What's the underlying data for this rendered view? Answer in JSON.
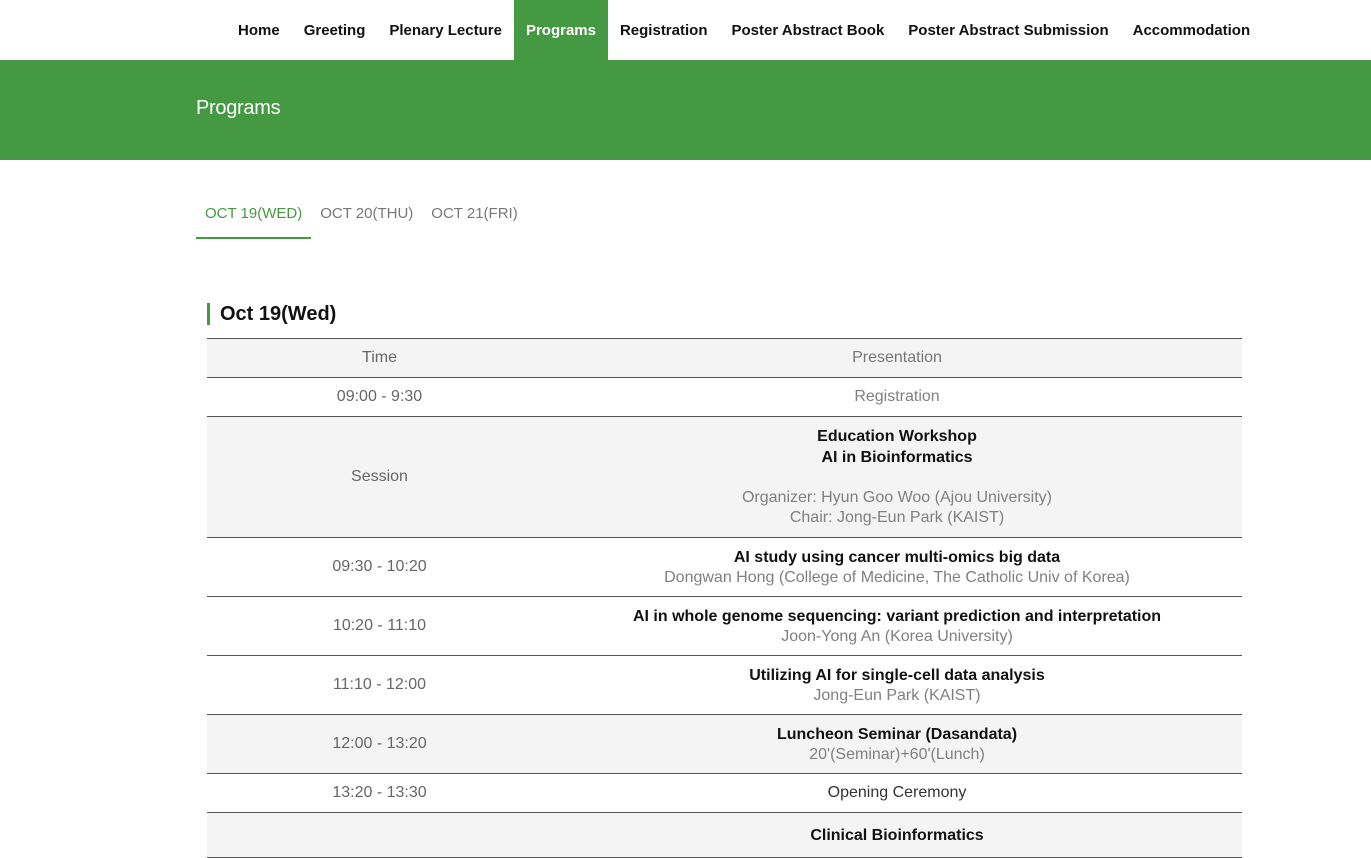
{
  "nav": {
    "items": [
      {
        "label": "Home",
        "active": false
      },
      {
        "label": "Greeting",
        "active": false
      },
      {
        "label": "Plenary Lecture",
        "active": false
      },
      {
        "label": "Programs",
        "active": true
      },
      {
        "label": "Registration",
        "active": false
      },
      {
        "label": "Poster Abstract Book",
        "active": false
      },
      {
        "label": "Poster Abstract Submission",
        "active": false
      },
      {
        "label": "Accommodation",
        "active": false
      }
    ]
  },
  "banner": {
    "title": "Programs"
  },
  "day_tabs": [
    {
      "label": "OCT 19(WED)",
      "active": true
    },
    {
      "label": "OCT 20(THU)",
      "active": false
    },
    {
      "label": "OCT 21(FRI)",
      "active": false
    }
  ],
  "day_heading": "Oct 19(Wed)",
  "table": {
    "headers": {
      "time": "Time",
      "presentation": "Presentation"
    },
    "rows": [
      {
        "time": "09:00 - 9:30",
        "plain": "Registration"
      },
      {
        "time": "Session",
        "title1": "Education Workshop",
        "title2": "AI in Bioinformatics",
        "sub1": "Organizer: Hyun Goo Woo (Ajou University)",
        "sub2": "Chair: Jong-Eun Park (KAIST)"
      },
      {
        "time": "09:30 - 10:20",
        "title": "AI study using cancer multi-omics big data",
        "sub": "Dongwan Hong (College of Medicine, The Catholic Univ of Korea)"
      },
      {
        "time": "10:20 - 11:10",
        "title": "AI in whole genome sequencing: variant prediction and interpretation",
        "sub": "Joon-Yong An (Korea University)"
      },
      {
        "time": "11:10 - 12:00",
        "title": "Utilizing AI for single-cell data analysis",
        "sub": "Jong-Eun Park (KAIST)"
      },
      {
        "time": "12:00 - 13:20",
        "title": "Luncheon Seminar (Dasandata)",
        "sub": "20'(Seminar)+60'(Lunch)"
      },
      {
        "time": "13:20 - 13:30",
        "plain": "Opening Ceremony"
      },
      {
        "time": "",
        "title": "Clinical Bioinformatics"
      }
    ]
  },
  "colors": {
    "accent": "#459943",
    "shade": "#f4f4f4"
  }
}
